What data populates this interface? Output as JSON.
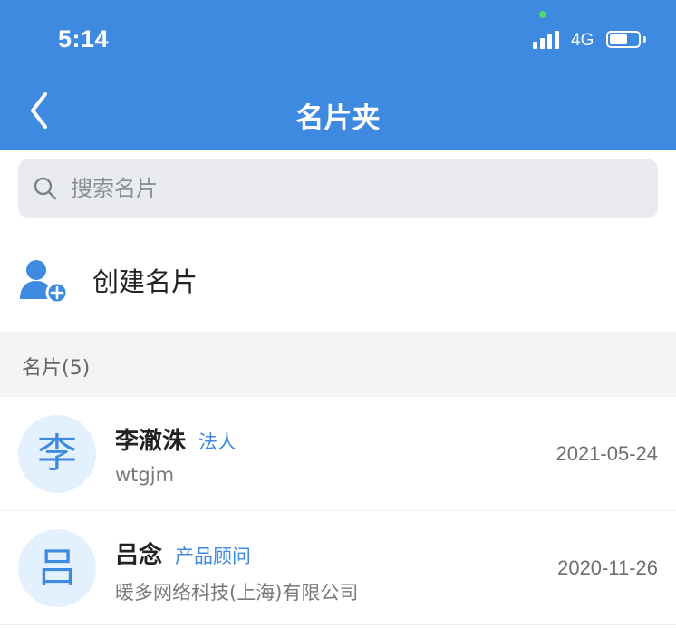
{
  "status_bar": {
    "time": "5:14",
    "network": "4G",
    "battery_level": 0.68
  },
  "nav": {
    "title": "名片夹",
    "back_icon": "chevron-left-icon"
  },
  "search": {
    "placeholder": "搜索名片",
    "value": "",
    "icon": "search-icon"
  },
  "create": {
    "label": "创建名片",
    "icon": "add-user-icon"
  },
  "section": {
    "label": "名片(5)"
  },
  "cards": [
    {
      "avatar": "李",
      "name": "李澈洙",
      "role": "法人",
      "subtitle": "wtgjm",
      "date": "2021-05-24"
    },
    {
      "avatar": "吕",
      "name": "吕念",
      "role": "产品顾问",
      "subtitle": "暖多网络科技(上海)有限公司",
      "date": "2020-11-26"
    }
  ],
  "colors": {
    "primary": "#3d8ae0",
    "avatar_bg": "#e3f0fd",
    "section_bg": "#f3f4f6",
    "search_bg": "#e9ebee"
  }
}
